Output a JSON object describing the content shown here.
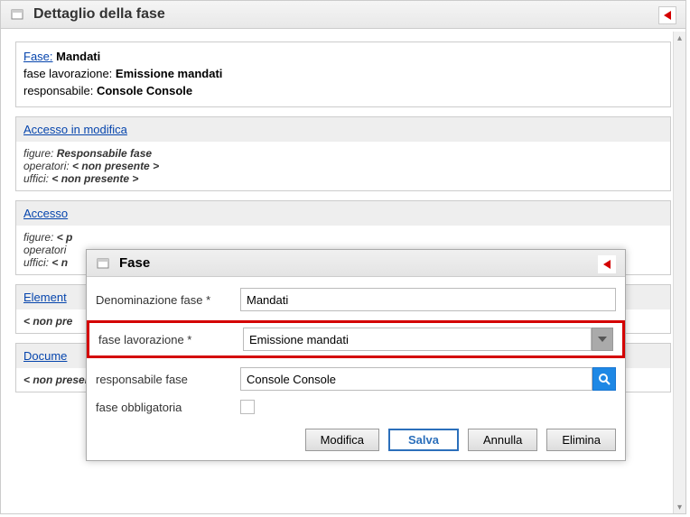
{
  "header": {
    "title": "Dettaglio della fase"
  },
  "info": {
    "fase_label": "Fase:",
    "fase_value": "Mandati",
    "lavorazione_label": "fase lavorazione:",
    "lavorazione_value": "Emissione mandati",
    "responsabile_label": "responsabile:",
    "responsabile_value": "Console Console"
  },
  "accesso_modifica": {
    "title": "Accesso in modifica",
    "figure_label": "figure:",
    "figure_value": "Responsabile fase",
    "operatori_label": "operatori:",
    "operatori_value": "< non presente >",
    "uffici_label": "uffici:",
    "uffici_value": "< non presente >"
  },
  "accesso_lettura": {
    "title_partial": "Accesso",
    "figure_label": "figure:",
    "figure_value_partial": "< p",
    "operatori_label_partial": "operatori",
    "uffici_label_partial": "uffici:",
    "uffici_value_partial": "< n"
  },
  "elementi": {
    "title_partial": "Element",
    "value_partial": "< non pre"
  },
  "documenti": {
    "title_partial": "Docume",
    "value": "< non presente >"
  },
  "modal": {
    "title": "Fase",
    "denominazione_label": "Denominazione fase *",
    "denominazione_value": "Mandati",
    "lavorazione_label": "fase lavorazione *",
    "lavorazione_value": "Emissione mandati",
    "responsabile_label": "responsabile fase",
    "responsabile_value": "Console Console",
    "obbligatoria_label": "fase obbligatoria",
    "buttons": {
      "modifica": "Modifica",
      "salva": "Salva",
      "annulla": "Annulla",
      "elimina": "Elimina"
    }
  }
}
